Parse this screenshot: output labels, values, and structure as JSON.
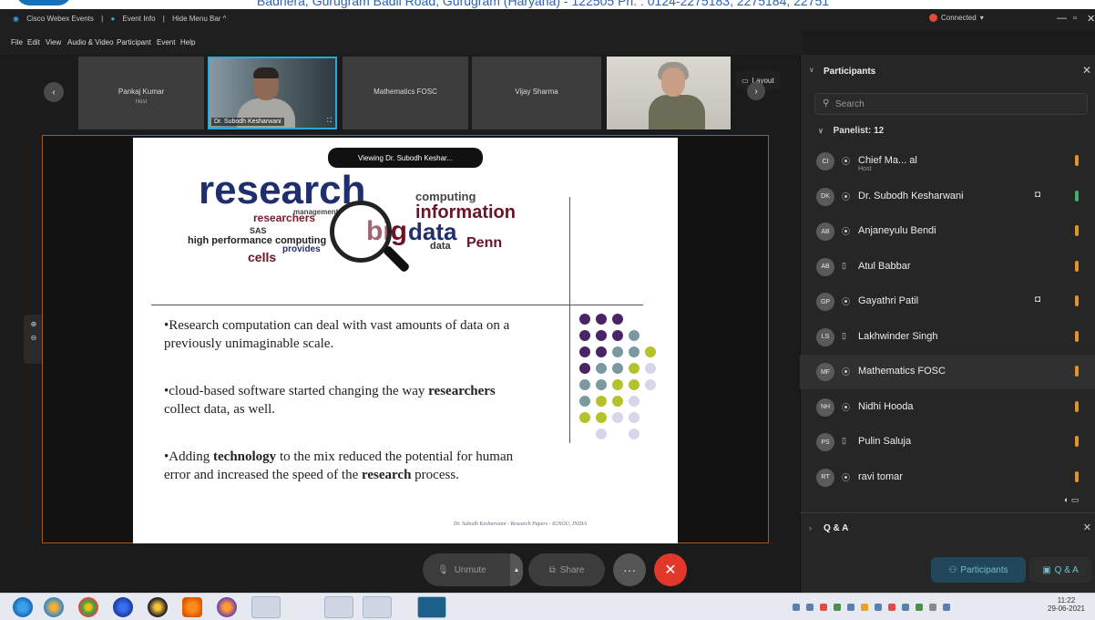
{
  "header": {
    "address_text": "Badhera, Gurugram Badli Road, Gurugram (Haryana) - 122505 Ph. : 0124-2275183, 2275184, 22751"
  },
  "titlebar": {
    "app_name": "Cisco Webex Events",
    "event_info": "Event Info",
    "hide_menu_bar": "Hide Menu Bar ^",
    "connection_status": "Connected",
    "status_color": "#e5493a"
  },
  "menu": [
    "File",
    "Edit",
    "View",
    "Audio & Video",
    "Participant",
    "Event",
    "Help"
  ],
  "video_strip": {
    "tiles": [
      {
        "name": "Pankaj Kumar",
        "sub": "Host"
      },
      {
        "name": "Dr. Subodh Kesharwani"
      },
      {
        "name": "Mathematics FOSC"
      },
      {
        "name": "Vijay Sharma"
      }
    ],
    "layout_label": "Layout"
  },
  "slide": {
    "tooltip": "Viewing Dr. Subodh Keshar...",
    "word_cloud": [
      "research",
      "computing",
      "information",
      "researchers",
      "big",
      "data",
      "Penn",
      "high performance computing",
      "cells",
      "provides",
      "data",
      "SAS",
      "management"
    ],
    "bullets": [
      {
        "pre": "•Research computation can deal with vast amounts of data on a previously unimaginable scale.",
        "bold": "",
        "post": ""
      },
      {
        "pre": "•cloud-based software started changing the way ",
        "bold": "researchers",
        "post": " collect data, as well."
      },
      {
        "pre": "•Adding ",
        "bold": "technology",
        "post": " to the mix reduced the potential for human error and increased the speed of the "
      }
    ],
    "bullet3_bold2": "research",
    "bullet3_end": " process.",
    "signature": "Dr. Subodh Kesharwani - Research Papers - IGNOU, INDIA"
  },
  "controls": {
    "unmute": "Unmute",
    "share": "Share",
    "more": "···",
    "leave": "✕"
  },
  "participants_panel": {
    "title": "Participants",
    "search_placeholder": "Search",
    "panelist_label": "Panelist: 12",
    "panelists": [
      {
        "initials": "CI",
        "name": "Chief Ma...    al",
        "sub": "Host",
        "cam": "",
        "mic": "orange"
      },
      {
        "initials": "DK",
        "name": "Dr. Subodh Kesharwani",
        "cam": "◘",
        "mic": "green"
      },
      {
        "initials": "AB",
        "name": "Anjaneyulu Bendi",
        "cam": "",
        "mic": "orange"
      },
      {
        "initials": "AB",
        "name": "Atul Babbar",
        "cam": "",
        "mic": "orange"
      },
      {
        "initials": "GP",
        "name": "Gayathri Patil",
        "cam": "◘",
        "mic": "orange"
      },
      {
        "initials": "LS",
        "name": "Lakhwinder Singh",
        "cam": "",
        "mic": "orange"
      },
      {
        "initials": "MF",
        "name": "Mathematics FOSC",
        "cam": "",
        "mic": "orange"
      },
      {
        "initials": "NH",
        "name": "Nidhi Hooda",
        "cam": "",
        "mic": "orange"
      },
      {
        "initials": "PS",
        "name": "Pulin Saluja",
        "cam": "",
        "mic": "orange"
      },
      {
        "initials": "RT",
        "name": "ravi tomar",
        "cam": "",
        "mic": "orange"
      }
    ],
    "qa_label": "Q & A",
    "participants_button": "Participants",
    "qa_button": "Q & A"
  },
  "taskbar": {
    "time": "11:22",
    "date": "29-06-2021"
  },
  "colors": {
    "accent": "#2aa9d6",
    "leave_red": "#e2372b",
    "mic_orange": "#e2932a",
    "mic_green": "#3bb16b",
    "slide_dots": [
      "#4b2466",
      "#7a9aa2",
      "#b5c22e",
      "#d5d6e8"
    ]
  }
}
